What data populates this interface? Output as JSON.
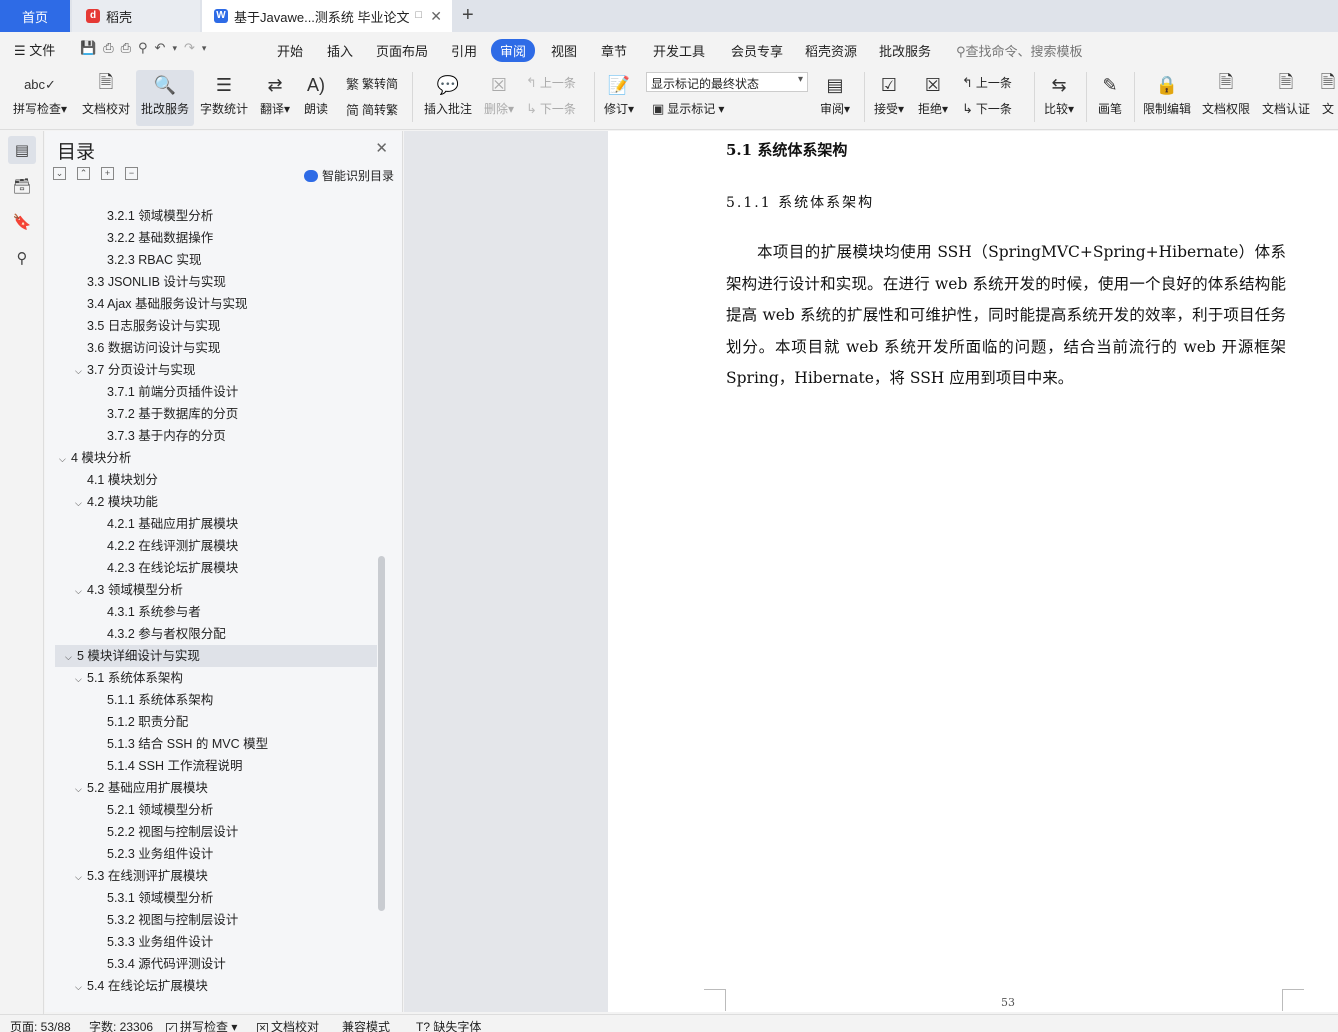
{
  "tabs": {
    "home": "首页",
    "daoke": "稻壳",
    "doc": "基于Javawe...测系统 毕业论文",
    "add": "+"
  },
  "menu": {
    "file": "文件",
    "items": [
      "开始",
      "插入",
      "页面布局",
      "引用",
      "审阅",
      "视图",
      "章节",
      "开发工具",
      "会员专享",
      "稻壳资源",
      "批改服务"
    ],
    "active": "审阅",
    "search": "查找命令、搜索模板"
  },
  "ribbon": {
    "spell": "拼写检查",
    "doccheck": "文档校对",
    "correct": "批改服务",
    "wordcount": "字数统计",
    "translate": "翻译",
    "read": "朗读",
    "to_trad": "繁转简",
    "to_simp": "简转繁",
    "insert_comment": "插入批注",
    "delete": "删除",
    "prev": "上一条",
    "next": "下一条",
    "revise": "修订",
    "markup_state": "显示标记的最终状态",
    "show_markup": "显示标记",
    "review": "审阅",
    "accept": "接受",
    "reject": "拒绝",
    "prev2": "上一条",
    "next2": "下一条",
    "compare": "比较",
    "pen": "画笔",
    "restrict": "限制编辑",
    "permission": "文档权限",
    "certify": "文档认证",
    "cut_label": "文"
  },
  "toc": {
    "title": "目录",
    "smart": "智能识别目录",
    "items": [
      {
        "text": "3.2.1  领域模型分析",
        "level": 3,
        "chev": ""
      },
      {
        "text": "3.2.2  基础数据操作",
        "level": 3,
        "chev": ""
      },
      {
        "text": "3.2.3 RBAC 实现",
        "level": 3,
        "chev": ""
      },
      {
        "text": "3.3 JSONLIB 设计与实现",
        "level": 2,
        "chev": ""
      },
      {
        "text": "3.4 Ajax 基础服务设计与实现",
        "level": 2,
        "chev": ""
      },
      {
        "text": "3.5  日志服务设计与实现",
        "level": 2,
        "chev": ""
      },
      {
        "text": "3.6  数据访问设计与实现",
        "level": 2,
        "chev": ""
      },
      {
        "text": "3.7  分页设计与实现",
        "level": 2,
        "chev": "v"
      },
      {
        "text": "3.7.1  前端分页插件设计",
        "level": 3,
        "chev": ""
      },
      {
        "text": "3.7.2  基于数据库的分页",
        "level": 3,
        "chev": ""
      },
      {
        "text": "3.7.3  基于内存的分页",
        "level": 3,
        "chev": ""
      },
      {
        "text": "4  模块分析",
        "level": 1,
        "chev": "v"
      },
      {
        "text": "4.1  模块划分",
        "level": 2,
        "chev": ""
      },
      {
        "text": "4.2  模块功能",
        "level": 2,
        "chev": "v"
      },
      {
        "text": "4.2.1  基础应用扩展模块",
        "level": 3,
        "chev": ""
      },
      {
        "text": "4.2.2  在线评测扩展模块",
        "level": 3,
        "chev": ""
      },
      {
        "text": "4.2.3  在线论坛扩展模块",
        "level": 3,
        "chev": ""
      },
      {
        "text": "4.3  领域模型分析",
        "level": 2,
        "chev": "v"
      },
      {
        "text": "4.3.1  系统参与者",
        "level": 3,
        "chev": ""
      },
      {
        "text": "4.3.2  参与者权限分配",
        "level": 3,
        "chev": ""
      },
      {
        "text": "5  模块详细设计与实现",
        "level": 1,
        "chev": "v",
        "selected": true
      },
      {
        "text": "5.1  系统体系架构",
        "level": 2,
        "chev": "v"
      },
      {
        "text": "5.1.1  系统体系架构",
        "level": 3,
        "chev": ""
      },
      {
        "text": "5.1.2  职责分配",
        "level": 3,
        "chev": ""
      },
      {
        "text": "5.1.3  结合 SSH 的 MVC 模型",
        "level": 3,
        "chev": ""
      },
      {
        "text": "5.1.4 SSH 工作流程说明",
        "level": 3,
        "chev": ""
      },
      {
        "text": "5.2  基础应用扩展模块",
        "level": 2,
        "chev": "v"
      },
      {
        "text": "5.2.1  领域模型分析",
        "level": 3,
        "chev": ""
      },
      {
        "text": "5.2.2  视图与控制层设计",
        "level": 3,
        "chev": ""
      },
      {
        "text": "5.2.3  业务组件设计",
        "level": 3,
        "chev": ""
      },
      {
        "text": "5.3  在线测评扩展模块",
        "level": 2,
        "chev": "v"
      },
      {
        "text": "5.3.1  领域模型分析",
        "level": 3,
        "chev": ""
      },
      {
        "text": "5.3.2  视图与控制层设计",
        "level": 3,
        "chev": ""
      },
      {
        "text": "5.3.3  业务组件设计",
        "level": 3,
        "chev": ""
      },
      {
        "text": "5.3.4  源代码评测设计",
        "level": 3,
        "chev": ""
      },
      {
        "text": "5.4  在线论坛扩展模块",
        "level": 2,
        "chev": "v"
      }
    ]
  },
  "document": {
    "h2": "5.1  系统体系架构",
    "h3": "5.1.1  系统体系架构",
    "paragraph": "本项目的扩展模块均使用 SSH（SpringMVC+Spring+Hibernate）体系架构进行设计和实现。在进行 web 系统开发的时候，使用一个良好的体系结构能提高 web 系统的扩展性和可维护性，同时能提高系统开发的效率，利于项目任务划分。本项目就 web 系统开发所面临的问题，结合当前流行的 web 开源框架 Spring，Hibernate，将 SSH 应用到项目中来。",
    "page_number": "53"
  },
  "status": {
    "page": "页面: 53/88",
    "words": "字数: 23306",
    "spell": "拼写检查",
    "doccheck": "文档校对",
    "compat": "兼容模式",
    "missing_font": "缺失字体"
  },
  "colors": {
    "accent": "#2e6be6"
  }
}
